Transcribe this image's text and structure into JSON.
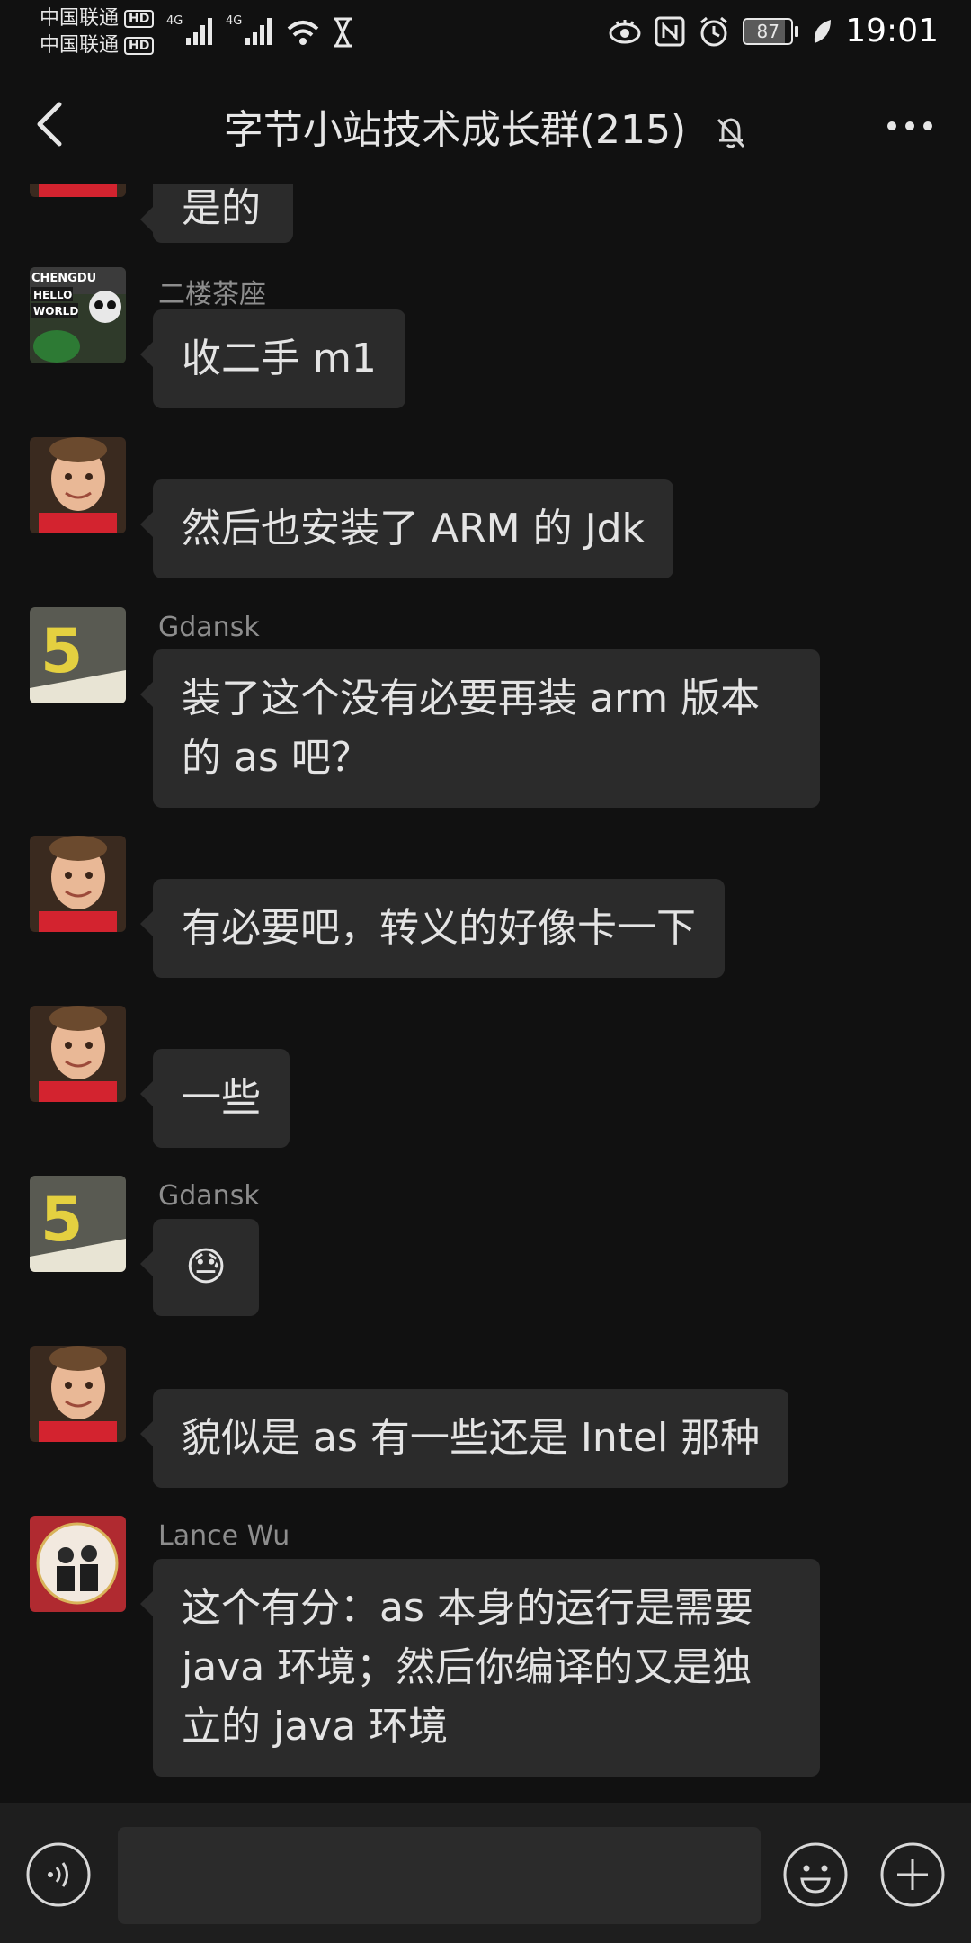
{
  "status_bar": {
    "carrier1": "中国联通",
    "carrier2": "中国联通",
    "hd_badge": "HD",
    "net_type": "4G",
    "battery": "87",
    "battery_level": 0.87,
    "time": "19:01"
  },
  "header": {
    "title": "字节小站技术成长群(215)"
  },
  "messages": [
    {
      "sender": "",
      "text": "是的"
    },
    {
      "sender": "二楼茶座",
      "text": "收二手 m1"
    },
    {
      "sender": "",
      "text": "然后也安装了 ARM 的 Jdk"
    },
    {
      "sender": "Gdansk",
      "text": "装了这个没有必要再装 arm 版本的 as 吧？"
    },
    {
      "sender": "",
      "text": "有必要吧，转义的好像卡一下"
    },
    {
      "sender": "",
      "text": "一些"
    },
    {
      "sender": "Gdansk",
      "text": "😓"
    },
    {
      "sender": "",
      "text": "貌似是 as 有一些还是 Intel 那种"
    },
    {
      "sender": "Lance Wu",
      "text": "这个有分：as 本身的运行是需要 java 环境；然后你编译的又是独立的 java 环境"
    }
  ],
  "avatar_logo_text": "CHENGDU HELLO WORLD",
  "avatar_number": "5",
  "colors": {
    "background": "#111111",
    "bubble": "#2b2b2b",
    "input_bar": "#1e1e1e"
  }
}
